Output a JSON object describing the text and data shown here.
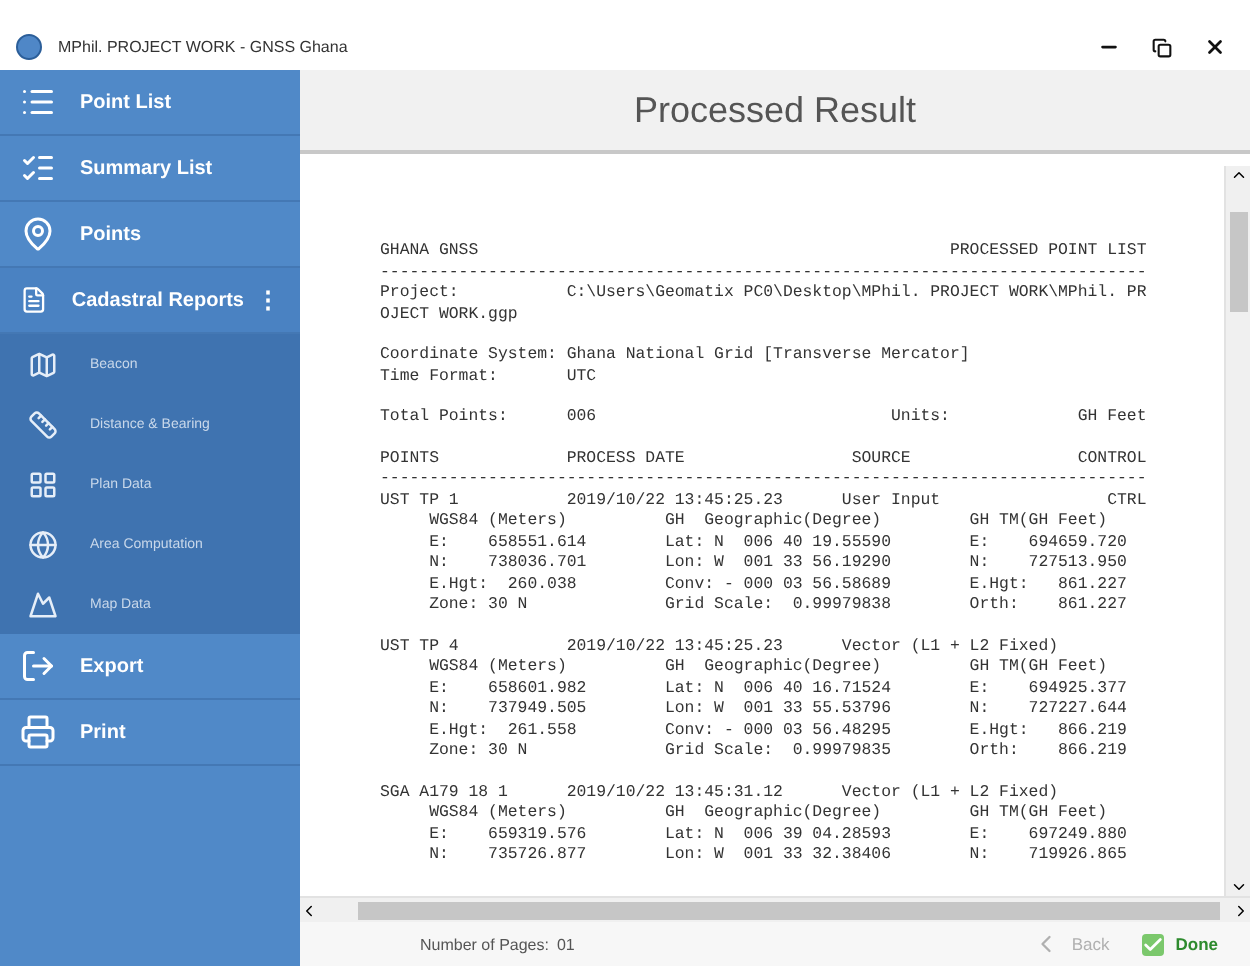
{
  "window": {
    "title": "MPhil. PROJECT WORK - GNSS Ghana"
  },
  "sidebar": {
    "items": [
      {
        "label": "Point List"
      },
      {
        "label": "Summary List"
      },
      {
        "label": "Points"
      },
      {
        "label": "Cadastral Reports",
        "expanded": true,
        "menu_glyph": "⋮",
        "children": [
          {
            "label": "Beacon"
          },
          {
            "label": "Distance & Bearing"
          },
          {
            "label": "Plan Data"
          },
          {
            "label": "Area Computation"
          },
          {
            "label": "Map Data"
          }
        ]
      },
      {
        "label": "Export"
      },
      {
        "label": "Print"
      }
    ]
  },
  "header": {
    "title": "Processed Result"
  },
  "report": {
    "blocks": [
      [
        "GHANA GNSS                                                PROCESSED POINT LIST",
        "------------------------------------------------------------------------------",
        "Project:           C:\\Users\\Geomatix PC0\\Desktop\\MPhil. PROJECT WORK\\MPhil. PR",
        "OJECT WORK.ggp"
      ],
      [
        "Coordinate System: Ghana National Grid [Transverse Mercator]",
        "Time Format:       UTC"
      ],
      [
        "Total Points:      006                              Units:             GH Feet"
      ],
      [
        "POINTS             PROCESS DATE                 SOURCE                 CONTROL",
        "------------------------------------------------------------------------------",
        "UST TP 1           2019/10/22 13:45:25.23      User Input                 CTRL",
        "     WGS84 (Meters)          GH  Geographic(Degree)         GH TM(GH Feet)",
        "     E:    658551.614        Lat: N  006 40 19.55590        E:    694659.720",
        "     N:    738036.701        Lon: W  001 33 56.19290        N:    727513.950",
        "     E.Hgt:  260.038         Conv: - 000 03 56.58689        E.Hgt:   861.227",
        "     Zone: 30 N              Grid Scale:  0.99979838        Orth:    861.227"
      ],
      [
        "UST TP 4           2019/10/22 13:45:25.23      Vector (L1 + L2 Fixed)",
        "     WGS84 (Meters)          GH  Geographic(Degree)         GH TM(GH Feet)",
        "     E:    658601.982        Lat: N  006 40 16.71524        E:    694925.377",
        "     N:    737949.505        Lon: W  001 33 55.53796        N:    727227.644",
        "     E.Hgt:  261.558         Conv: - 000 03 56.48295        E.Hgt:   866.219",
        "     Zone: 30 N              Grid Scale:  0.99979835        Orth:    866.219"
      ],
      [
        "SGA A179 18 1      2019/10/22 13:45:31.12      Vector (L1 + L2 Fixed)",
        "     WGS84 (Meters)          GH  Geographic(Degree)         GH TM(GH Feet)",
        "     E:    659319.576        Lat: N  006 39 04.28593        E:    697249.880",
        "     N:    735726.877        Lon: W  001 33 32.38406        N:    719926.865"
      ]
    ]
  },
  "footer": {
    "pages_label": "Number of Pages:",
    "pages": "01",
    "back": {
      "label": "Back",
      "disabled": true
    },
    "done": {
      "label": "Done",
      "disabled": false
    }
  }
}
